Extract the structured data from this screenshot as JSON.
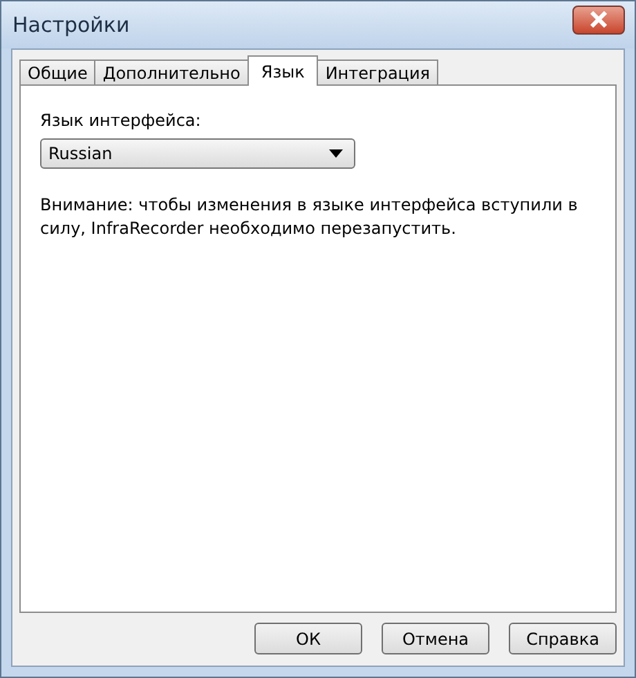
{
  "window": {
    "title": "Настройки"
  },
  "tabs": [
    {
      "label": "Общие",
      "selected": false
    },
    {
      "label": "Дополнительно",
      "selected": false
    },
    {
      "label": "Язык",
      "selected": true
    },
    {
      "label": "Интеграция",
      "selected": false
    }
  ],
  "language": {
    "label": "Язык интерфейса:",
    "value": "Russian"
  },
  "note": "Внимание: чтобы изменения в языке интерфейса вступили в силу, InfraRecorder необходимо перезапустить.",
  "buttons": [
    "ОК",
    "Отмена",
    "Справка"
  ]
}
